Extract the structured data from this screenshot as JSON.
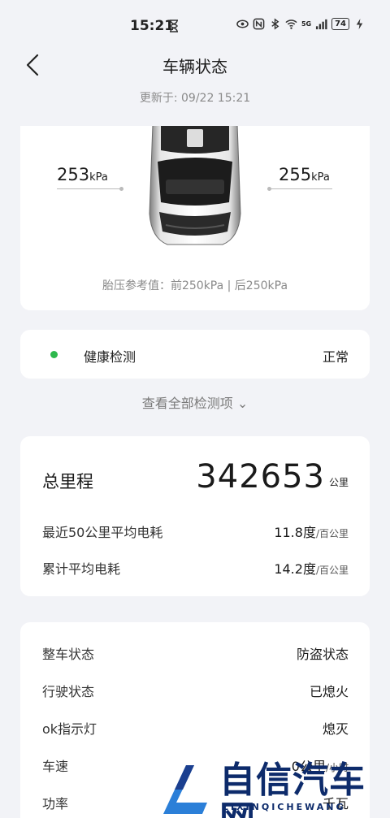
{
  "status_bar": {
    "time": "15:21",
    "battery": "74",
    "network": "5G",
    "icons": [
      "hourglass-icon",
      "eye-icon",
      "nfc-icon",
      "bluetooth-icon",
      "wifi-icon",
      "signal-icon",
      "battery-icon",
      "charging-icon"
    ]
  },
  "header": {
    "title": "车辆状态",
    "updated": "更新于: 09/22 15:21"
  },
  "tire": {
    "left_value": "253",
    "right_value": "255",
    "unit": "kPa",
    "reference": "胎压参考值：前250kPa | 后250kPa"
  },
  "health": {
    "label": "健康检测",
    "status": "正常",
    "status_color": "#2db84c"
  },
  "view_all": "查看全部检测项 ⌄",
  "mileage": {
    "label": "总里程",
    "value": "342653",
    "unit": "公里",
    "rows": [
      {
        "label": "最近50公里平均电耗",
        "value": "11.8度",
        "unit": "/百公里"
      },
      {
        "label": "累计平均电耗",
        "value": "14.2度",
        "unit": "/百公里"
      }
    ]
  },
  "vehicle_state": {
    "rows": [
      {
        "label": "整车状态",
        "value": "防盗状态",
        "unit": ""
      },
      {
        "label": "行驶状态",
        "value": "已熄火",
        "unit": ""
      },
      {
        "label": "ok指示灯",
        "value": "熄灭",
        "unit": ""
      },
      {
        "label": "车速",
        "value": "0公里",
        "unit": "/小时"
      },
      {
        "label": "功率",
        "value": "千瓦",
        "unit": ""
      }
    ]
  },
  "watermark": {
    "text": "自信汽车网",
    "sub": "ZIXINQICHEWANG"
  }
}
